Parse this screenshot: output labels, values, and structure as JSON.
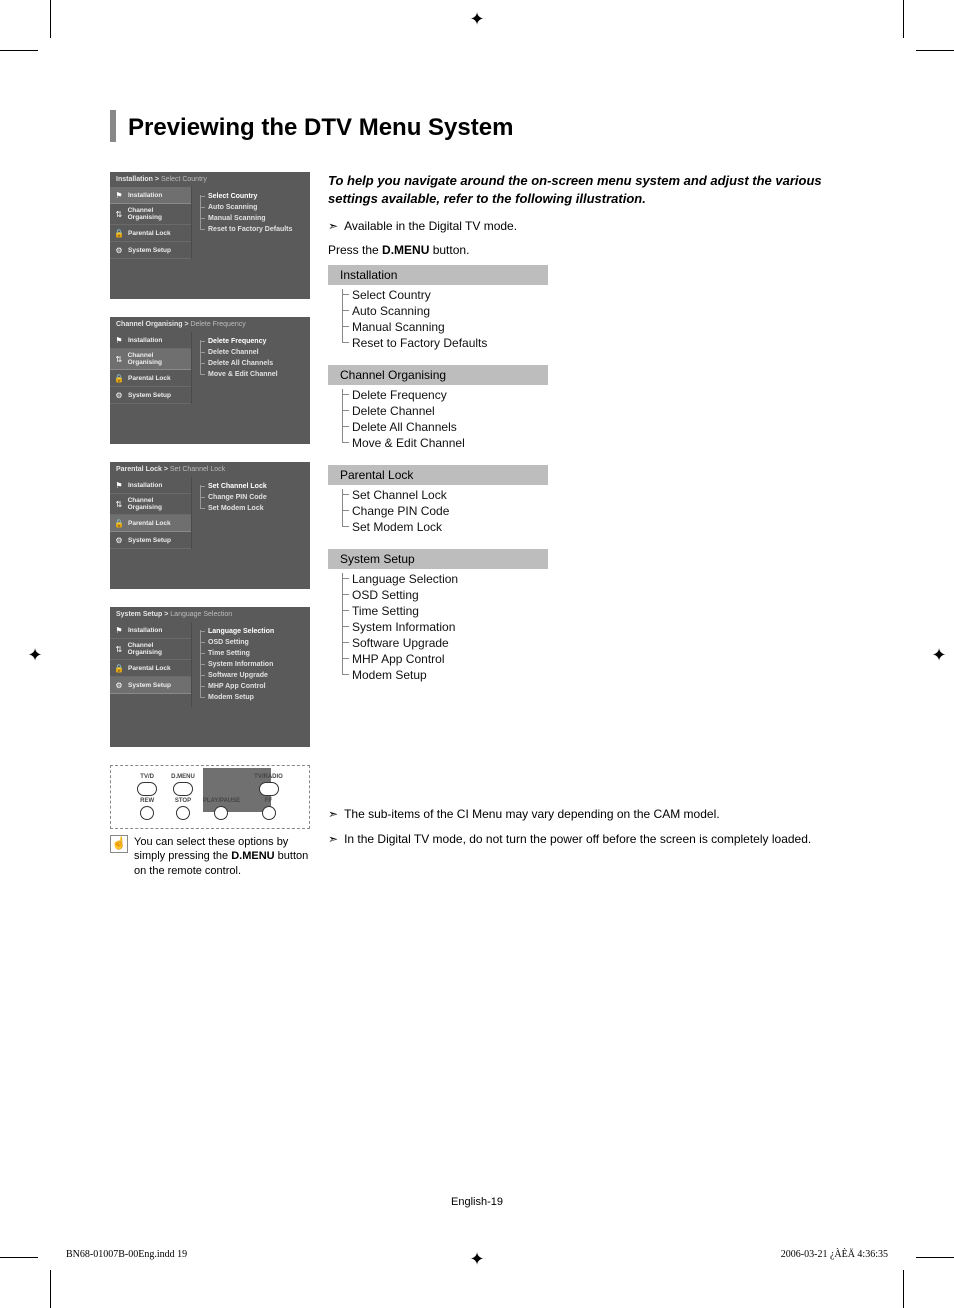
{
  "title": "Previewing the DTV Menu System",
  "intro": "To help you navigate around the on-screen menu system and adjust the various settings available, refer to the following illustration.",
  "note_available": "Available in the Digital TV mode.",
  "instruction_prefix": "Press the ",
  "instruction_bold": "D.MENU",
  "instruction_suffix": " button.",
  "tree": [
    {
      "head": "Installation",
      "items": [
        "Select Country",
        "Auto Scanning",
        "Manual Scanning",
        "Reset to Factory Defaults"
      ]
    },
    {
      "head": "Channel Organising",
      "items": [
        "Delete Frequency",
        "Delete Channel",
        "Delete All Channels",
        "Move & Edit Channel"
      ]
    },
    {
      "head": "Parental Lock",
      "items": [
        "Set Channel Lock",
        "Change PIN Code",
        "Set Modem Lock"
      ]
    },
    {
      "head": "System Setup",
      "items": [
        "Language Selection",
        "OSD Setting",
        "Time Setting",
        "System Information",
        "Software Upgrade",
        "MHP App Control",
        "Modem Setup"
      ]
    }
  ],
  "note_ci": "The sub-items of the CI Menu may vary depending on the CAM model.",
  "note_power": "In the Digital TV mode, do not turn the power off before the screen is completely loaded.",
  "screens": [
    {
      "bc_main": "Installation",
      "bc_sub": "Select Country",
      "left_active": 0,
      "left": [
        "Installation",
        "Channel Organising",
        "Parental Lock",
        "System Setup"
      ],
      "right": [
        "Select Country",
        "Auto Scanning",
        "Manual Scanning",
        "Reset to Factory Defaults"
      ]
    },
    {
      "bc_main": "Channel Organising",
      "bc_sub": "Delete Frequency",
      "left_active": 1,
      "left": [
        "Installation",
        "Channel Organising",
        "Parental Lock",
        "System Setup"
      ],
      "right": [
        "Delete Frequency",
        "Delete Channel",
        "Delete All Channels",
        "Move & Edit Channel"
      ]
    },
    {
      "bc_main": "Parental Lock",
      "bc_sub": "Set Channel Lock",
      "left_active": 2,
      "left": [
        "Installation",
        "Channel Organising",
        "Parental Lock",
        "System Setup"
      ],
      "right": [
        "Set Channel Lock",
        "Change PIN Code",
        "Set Modem Lock"
      ]
    },
    {
      "bc_main": "System Setup",
      "bc_sub": "Language Selection",
      "left_active": 3,
      "left": [
        "Installation",
        "Channel Organising",
        "Parental Lock",
        "System Setup"
      ],
      "right": [
        "Language Selection",
        "OSD Setting",
        "Time Setting",
        "System Information",
        "Software Upgrade",
        "MHP App Control",
        "Modem Setup"
      ]
    }
  ],
  "left_icons": [
    "flag-icon",
    "swap-icon",
    "lock-icon",
    "gear-icon"
  ],
  "remote": {
    "labels_top": [
      "TV/D",
      "D.MENU",
      "TV/RADIO"
    ],
    "row2": [
      "REW",
      "STOP",
      "PLAY/PAUSE",
      "FF"
    ]
  },
  "caption_prefix": "You can select these options by simply pressing the ",
  "caption_bold": "D.MENU",
  "caption_suffix": " button on the remote control.",
  "footer_page": "English-19",
  "print_left": "BN68-01007B-00Eng.indd   19",
  "print_right": "2006-03-21   ¿ÀÈÄ 4:36:35"
}
